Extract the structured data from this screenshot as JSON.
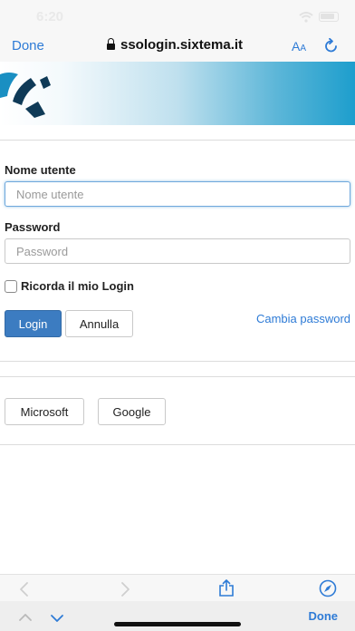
{
  "status_bar": {
    "time": "6:20"
  },
  "browser": {
    "done_label": "Done",
    "url": "ssologin.sixtema.it",
    "text_size_label": "AA"
  },
  "form": {
    "username_label": "Nome utente",
    "username_placeholder": "Nome utente",
    "username_value": "",
    "password_label": "Password",
    "password_placeholder": "Password",
    "password_value": "",
    "remember_label": "Ricorda il mio Login",
    "remember_checked": false,
    "login_button": "Login",
    "cancel_button": "Annulla",
    "change_password_link": "Cambia password"
  },
  "external_login": {
    "microsoft_button": "Microsoft",
    "google_button": "Google"
  },
  "keyboard_accessory": {
    "done_label": "Done"
  },
  "colors": {
    "accent": "#2e7bd6",
    "primary_button": "#3c7cc1",
    "banner_gradient_end": "#1d9ecd",
    "logo_dark": "#0f3a57",
    "logo_teal": "#1a8fc2"
  }
}
